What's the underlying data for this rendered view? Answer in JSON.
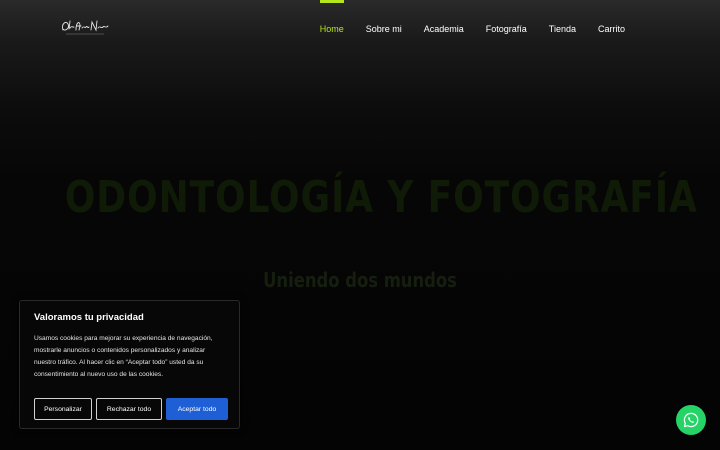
{
  "nav": {
    "items": [
      {
        "label": "Home",
        "active": true
      },
      {
        "label": "Sobre mi",
        "active": false
      },
      {
        "label": "Academia",
        "active": false
      },
      {
        "label": "Fotografía",
        "active": false
      },
      {
        "label": "Tienda",
        "active": false
      },
      {
        "label": "Carrito",
        "active": false
      }
    ]
  },
  "hero": {
    "title": "ODONTOLOGÍA Y FOTOGRAFÍA",
    "subtitle": "Uniendo dos mundos"
  },
  "cookie": {
    "title": "Valoramos tu privacidad",
    "text": "Usamos cookies para mejorar su experiencia de navegación, mostrarle anuncios o contenidos personalizados y analizar nuestro tráfico. Al hacer clic en “Aceptar todo” usted da su consentimiento al nuevo uso de las cookies.",
    "customize_label": "Personalizar",
    "reject_label": "Rechazar todo",
    "accept_label": "Aceptar todo"
  },
  "colors": {
    "accent": "#b5e61d",
    "primary_button": "#1e5fd6",
    "whatsapp": "#25d366"
  },
  "icons": {
    "logo": "signature-logo",
    "chat": "whatsapp-icon"
  }
}
